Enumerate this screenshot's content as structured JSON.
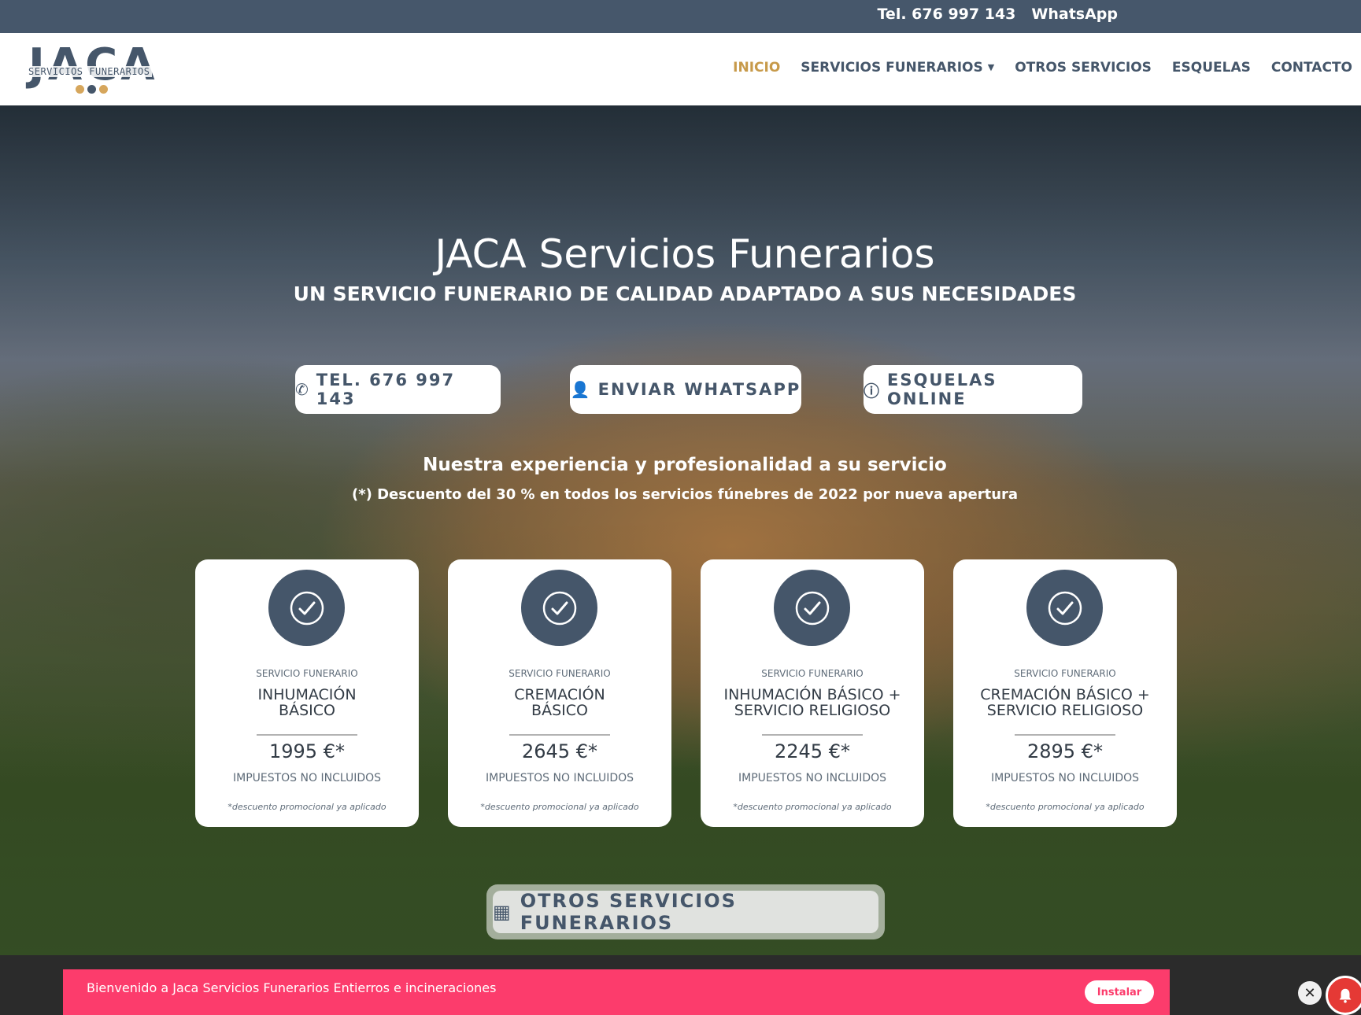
{
  "topbar": {
    "phone": "Tel. 676 997 143",
    "whatsapp": "WhatsApp"
  },
  "logo": {
    "letters": "JACA",
    "subtitle": "SERVICIOS FUNERARIOS",
    "dot_colors": [
      "#d6a65c",
      "#45566a",
      "#d6a65c"
    ]
  },
  "nav": {
    "items": [
      {
        "label": "INICIO",
        "active": true
      },
      {
        "label": "SERVICIOS FUNERARIOS",
        "chevron": "chevron-down-icon"
      },
      {
        "label": "OTROS SERVICIOS"
      },
      {
        "label": "ESQUELAS"
      },
      {
        "label": "CONTACTO"
      }
    ]
  },
  "hero": {
    "title": "JACA Servicios Funerarios",
    "subtitle": "UN SERVICIO FUNERARIO DE CALIDAD ADAPTADO A SUS NECESIDADES",
    "buttons": [
      {
        "label": "TEL. 676 997 143",
        "icon": "phone-icon"
      },
      {
        "label": "ENVIAR WHATSAPP",
        "icon": "user-icon"
      },
      {
        "label": "ESQUELAS ONLINE",
        "icon": "info-icon"
      }
    ],
    "tagline": "Nuestra experiencia y profesionalidad a su servicio",
    "promo": "(*) Descuento del 30 % en todos los servicios fúnebres de 2022 por nueva apertura"
  },
  "cards": [
    {
      "kicker": "SERVICIO FUNERARIO",
      "name_line1": "INHUMACIÓN",
      "name_line2": "BÁSICO",
      "price": "1995 €*",
      "tax": "IMPUESTOS NO INCLUIDOS",
      "note": "*descuento promocional ya aplicado"
    },
    {
      "kicker": "SERVICIO FUNERARIO",
      "name_line1": "CREMACIÓN",
      "name_line2": "BÁSICO",
      "price": "2645 €*",
      "tax": "IMPUESTOS NO INCLUIDOS",
      "note": "*descuento promocional ya aplicado"
    },
    {
      "kicker": "SERVICIO FUNERARIO",
      "name_line1": "INHUMACIÓN BÁSICO +",
      "name_line2": "SERVICIO RELIGIOSO",
      "price": "2245 €*",
      "tax": "IMPUESTOS NO INCLUIDOS",
      "note": "*descuento promocional ya aplicado"
    },
    {
      "kicker": "SERVICIO FUNERARIO",
      "name_line1": "CREMACIÓN BÁSICO +",
      "name_line2": "SERVICIO RELIGIOSO",
      "price": "2895 €*",
      "tax": "IMPUESTOS NO INCLUIDOS",
      "note": "*descuento promocional ya aplicado"
    }
  ],
  "other_services": {
    "label": "OTROS SERVICIOS FUNERARIOS",
    "icon": "grid-icon"
  },
  "install_banner": {
    "message": "Bienvenido a Jaca Servicios Funerarios Entierros e incineraciones",
    "button": "Instalar",
    "close": "✕"
  },
  "colors": {
    "brand": "#45566a",
    "accent": "#c79a4a",
    "banner": "#fc3c6c",
    "topbar": "#46576b"
  }
}
